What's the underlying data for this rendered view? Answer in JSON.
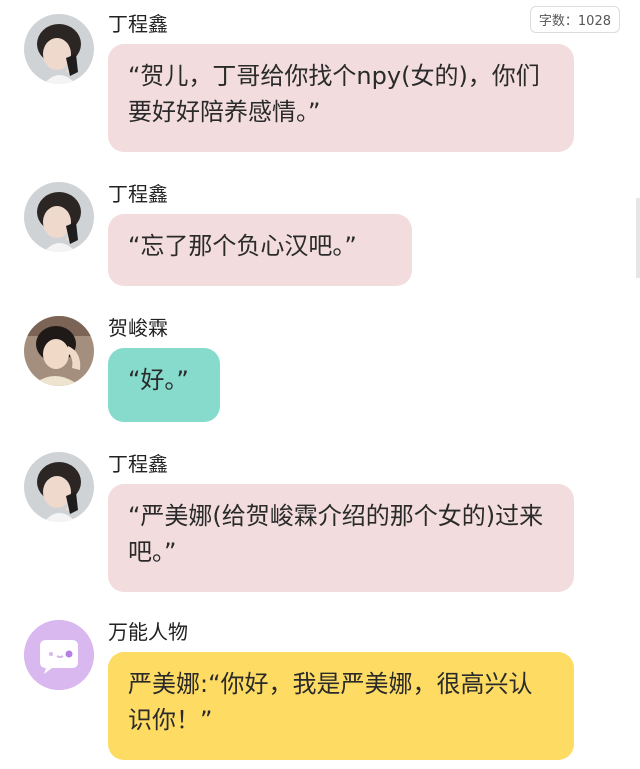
{
  "word_count": "字数：1028",
  "colors": {
    "bubble_pink": "#f2dcdd",
    "bubble_teal": "#86dbcd",
    "bubble_yellow": "#fedc64",
    "avatar_generic": "#d8b8ef"
  },
  "messages": [
    {
      "speaker": "丁程鑫",
      "text": "“贺儿，丁哥给你找个npy(女的)，你们要好好陪养感情。”",
      "avatar": "boy-avatar"
    },
    {
      "speaker": "丁程鑫",
      "text": "“忘了那个负心汉吧。”",
      "avatar": "boy-avatar"
    },
    {
      "speaker": "贺峻霖",
      "text": "“好。”",
      "avatar": "boy-avatar-2"
    },
    {
      "speaker": "丁程鑫",
      "text": "“严美娜(给贺峻霖介绍的那个女的)过来吧。”",
      "avatar": "boy-avatar"
    },
    {
      "speaker": "万能人物",
      "text": "严美娜:“你好，我是严美娜，很高兴认识你！”",
      "avatar": "chat-bubble-icon"
    }
  ]
}
